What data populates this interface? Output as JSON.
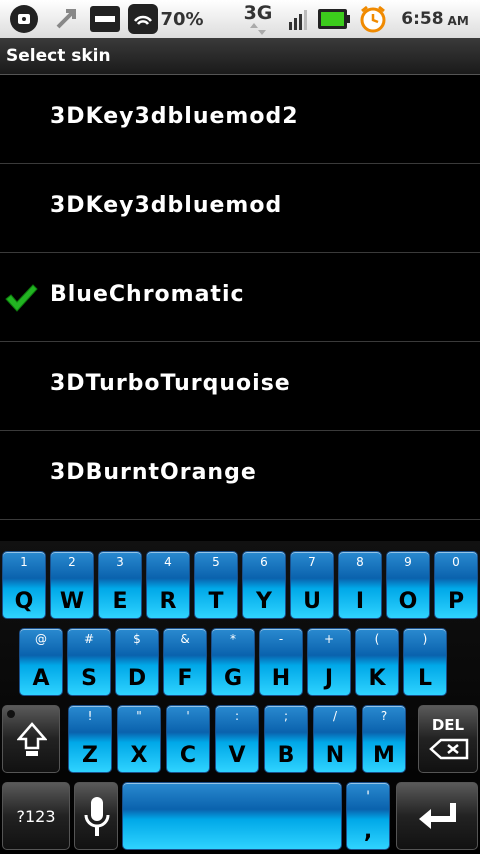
{
  "status_bar": {
    "battery_percent": "70%",
    "network": "3G",
    "time": "6:58",
    "ampm": "AM",
    "icons": [
      "app-circle-icon",
      "usb-icon",
      "mobile-data-icon",
      "wifi-icon",
      "signal-icon",
      "battery-icon",
      "alarm-icon"
    ]
  },
  "title": "Select skin",
  "skins": [
    {
      "label": "3DKey3dbluemod2",
      "selected": false
    },
    {
      "label": "3DKey3dbluemod",
      "selected": false
    },
    {
      "label": "BlueChromatic",
      "selected": true
    },
    {
      "label": "3DTurboTurquoise",
      "selected": false
    },
    {
      "label": "3DBurntOrange",
      "selected": false
    }
  ],
  "keyboard": {
    "row1": [
      {
        "num": "1",
        "let": "Q"
      },
      {
        "num": "2",
        "let": "W"
      },
      {
        "num": "3",
        "let": "E"
      },
      {
        "num": "4",
        "let": "R"
      },
      {
        "num": "5",
        "let": "T"
      },
      {
        "num": "6",
        "let": "Y"
      },
      {
        "num": "7",
        "let": "U"
      },
      {
        "num": "8",
        "let": "I"
      },
      {
        "num": "9",
        "let": "O"
      },
      {
        "num": "0",
        "let": "P"
      }
    ],
    "row2": [
      {
        "num": "@",
        "let": "A"
      },
      {
        "num": "#",
        "let": "S"
      },
      {
        "num": "$",
        "let": "D"
      },
      {
        "num": "&",
        "let": "F"
      },
      {
        "num": "*",
        "let": "G"
      },
      {
        "num": "-",
        "let": "H"
      },
      {
        "num": "+",
        "let": "J"
      },
      {
        "num": "(",
        "let": "K"
      },
      {
        "num": ")",
        "let": "L"
      }
    ],
    "row3": [
      {
        "num": "!",
        "let": "Z"
      },
      {
        "num": "\"",
        "let": "X"
      },
      {
        "num": "'",
        "let": "C"
      },
      {
        "num": ":",
        "let": "V"
      },
      {
        "num": ";",
        "let": "B"
      },
      {
        "num": "/",
        "let": "N"
      },
      {
        "num": "?",
        "let": "M"
      }
    ],
    "del_label": "DEL",
    "sym_label": "?123",
    "comma_top": "'",
    "comma_bottom": ","
  },
  "colors": {
    "accent": "#00a8e8",
    "check": "#22b422"
  }
}
